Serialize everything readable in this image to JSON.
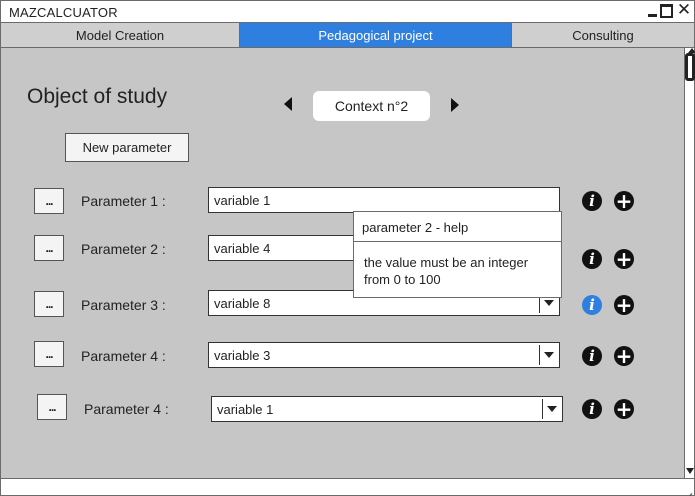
{
  "window": {
    "title": "MAZCALCUATOR"
  },
  "tabs": [
    {
      "label": "Model Creation",
      "active": false
    },
    {
      "label": "Pedagogical project",
      "active": true
    },
    {
      "label": "Consulting",
      "active": false
    }
  ],
  "main": {
    "title": "Object of study",
    "context": {
      "label": "Context n°2"
    },
    "new_parameter_label": "New parameter",
    "params": [
      {
        "dots": "...",
        "label": "Parameter 1 :",
        "value": "variable 1",
        "info_active": false
      },
      {
        "dots": "...",
        "label": "Parameter 2 :",
        "value": "variable 4",
        "info_active": false
      },
      {
        "dots": "...",
        "label": "Parameter 3 :",
        "value": "variable 8",
        "info_active": true
      },
      {
        "dots": "...",
        "label": "Parameter 4 :",
        "value": "variable 3",
        "info_active": false
      },
      {
        "dots": "...",
        "label": "Parameter 4 :",
        "value": "variable 1",
        "info_active": false
      }
    ]
  },
  "tooltip": {
    "title": "parameter 2 - help",
    "body": "the value must be an integer from 0 to 100"
  },
  "icons": {
    "info": "info-icon",
    "plus": "plus-circle-icon",
    "prev": "triangle-left-icon",
    "next": "triangle-right-icon"
  },
  "colors": {
    "accent": "#2f7fe0",
    "panel": "#c6c6c6",
    "tab": "#cfcfcf"
  }
}
